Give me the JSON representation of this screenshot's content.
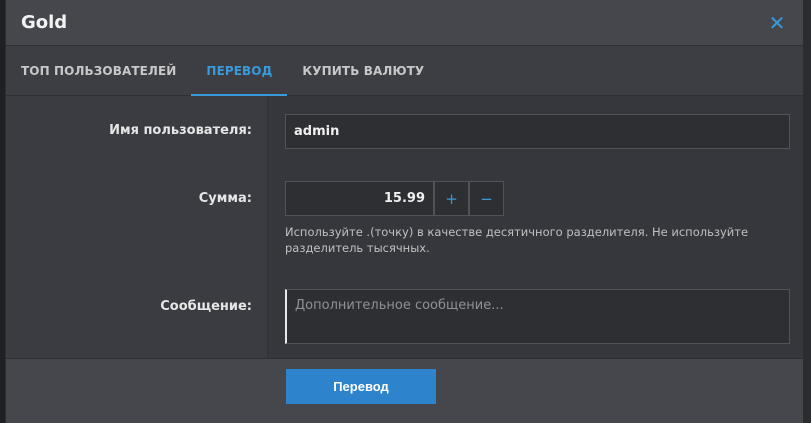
{
  "modal": {
    "title": "Gold",
    "close_glyph": "✕"
  },
  "tabs": [
    {
      "label": "ТОП ПОЛЬЗОВАТЕЛЕЙ",
      "active": false
    },
    {
      "label": "ПЕРЕВОД",
      "active": true
    },
    {
      "label": "КУПИТЬ ВАЛЮТУ",
      "active": false
    }
  ],
  "form": {
    "username_label": "Имя пользователя:",
    "username_value": "admin",
    "amount_label": "Сумма:",
    "amount_value": "15.99",
    "plus_glyph": "+",
    "minus_glyph": "−",
    "amount_hint": "Используйте .(точку) в качестве десятичного разделителя. Не используйте разделитель тысячных.",
    "message_label": "Сообщение:",
    "message_placeholder": "Дополнительное сообщение..."
  },
  "footer": {
    "submit_label": "Перевод"
  },
  "colors": {
    "accent": "#3a9ad9",
    "button": "#2d84cc"
  }
}
